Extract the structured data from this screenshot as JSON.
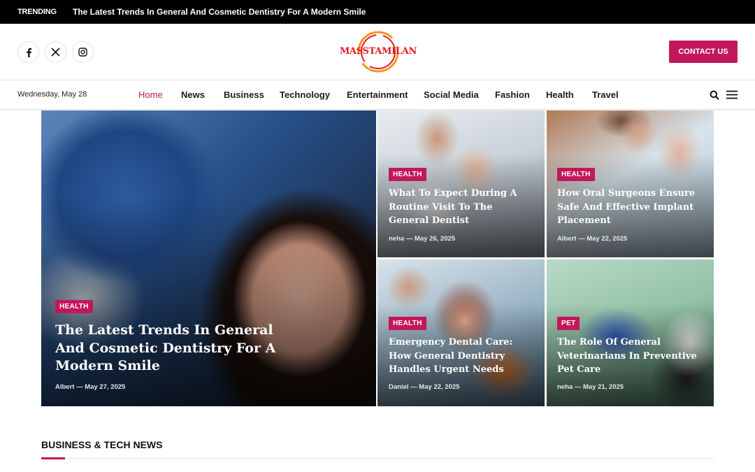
{
  "topbar": {
    "trending_label": "TRENDING",
    "trending_text": "The Latest Trends In General And Cosmetic Dentistry For A Modern Smile"
  },
  "header": {
    "logo_text": "MASSTAMILAN",
    "contact_label": "CONTACT US",
    "social": [
      "facebook-icon",
      "x-icon",
      "instagram-icon"
    ]
  },
  "nav": {
    "date": "Wednesday, May 28",
    "items": [
      {
        "label": "Home",
        "active": true
      },
      {
        "label": "News"
      },
      {
        "label": "Business"
      },
      {
        "label": "Technology"
      },
      {
        "label": "Entertainment"
      },
      {
        "label": "Social Media"
      },
      {
        "label": "Fashion"
      },
      {
        "label": "Health"
      },
      {
        "label": "Travel"
      }
    ]
  },
  "featured": {
    "main": {
      "category": "HEALTH",
      "title": "The Latest Trends In General And Cosmetic Dentistry For A Modern Smile",
      "author": "Albert",
      "date": "May 27, 2025"
    },
    "posts": [
      {
        "category": "HEALTH",
        "title": "What To Expect During A Routine Visit To The General Dentist",
        "author": "neha",
        "date": "May 26, 2025"
      },
      {
        "category": "HEALTH",
        "title": "How Oral Surgeons Ensure Safe And Effective Implant Placement",
        "author": "Albert",
        "date": "May 22, 2025"
      },
      {
        "category": "HEALTH",
        "title": "Emergency Dental Care: How General Dentistry Handles Urgent Needs",
        "author": "Daniel",
        "date": "May 22, 2025"
      },
      {
        "category": "PET",
        "title": "The Role Of General Veterinarians In Preventive Pet Care",
        "author": "neha",
        "date": "May 21, 2025"
      }
    ]
  },
  "section": {
    "title": "BUSINESS & TECH NEWS"
  },
  "colors": {
    "accent": "#c2185b",
    "topbar": "#000000",
    "logo_red": "#e31b23",
    "logo_orange": "#f7941d"
  }
}
